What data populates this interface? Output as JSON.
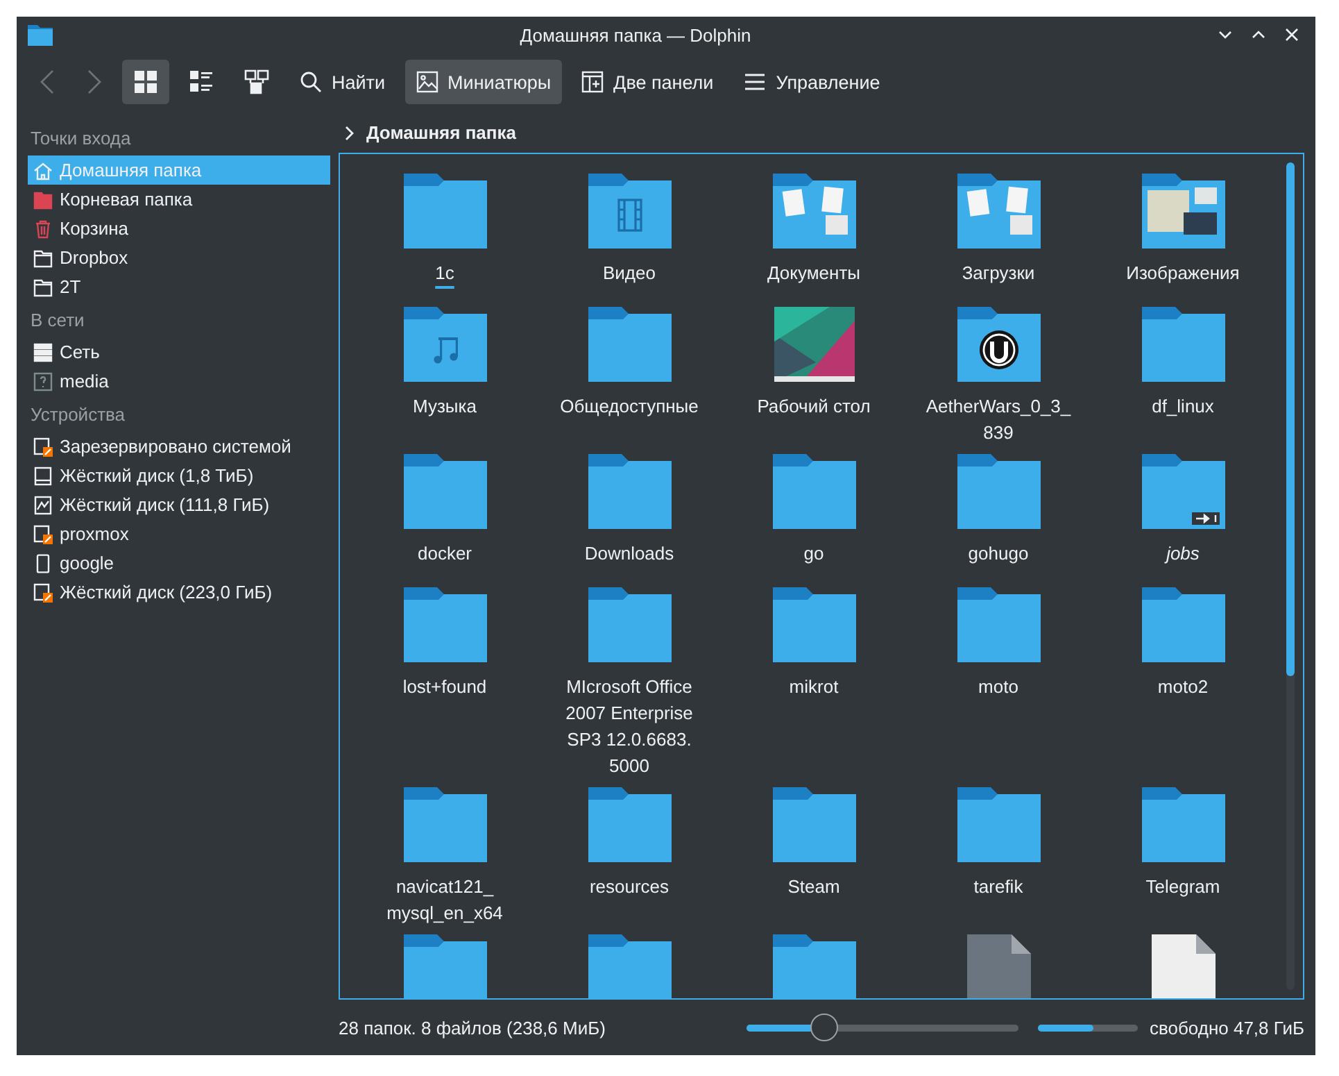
{
  "window": {
    "title": "Домашняя папка — Dolphin"
  },
  "toolbar": {
    "back": {
      "disabled": true
    },
    "forward": {
      "disabled": true
    },
    "view_modes": [
      {
        "kind": "icons",
        "selected": true
      },
      {
        "kind": "details",
        "selected": false
      },
      {
        "kind": "tree",
        "selected": false
      }
    ],
    "buttons": [
      {
        "kind": "search",
        "label": "Найти",
        "on": false
      },
      {
        "kind": "preview",
        "label": "Миниатюры",
        "on": true
      },
      {
        "kind": "split",
        "label": "Две панели",
        "on": false
      },
      {
        "kind": "menu",
        "label": "Управление",
        "on": false
      }
    ]
  },
  "sidebar": {
    "sections": [
      {
        "title": "Точки входа",
        "items": [
          {
            "kind": "home",
            "label": "Домашняя папка",
            "selected": true
          },
          {
            "kind": "root",
            "label": "Корневая папка",
            "selected": false
          },
          {
            "kind": "trash",
            "label": "Корзина",
            "selected": false
          },
          {
            "kind": "folder",
            "label": "Dropbox",
            "selected": false
          },
          {
            "kind": "folder",
            "label": "2T",
            "selected": false
          }
        ]
      },
      {
        "title": "В сети",
        "items": [
          {
            "kind": "network",
            "label": "Сеть",
            "selected": false
          },
          {
            "kind": "unknown",
            "label": "media",
            "selected": false
          }
        ]
      },
      {
        "title": "Устройства",
        "items": [
          {
            "kind": "drive-warn",
            "label": "Зарезервировано системой",
            "selected": false
          },
          {
            "kind": "drive",
            "label": "Жёсткий диск (1,8 ТиБ)",
            "selected": false
          },
          {
            "kind": "drive-image",
            "label": "Жёсткий диск (111,8 ГиБ)",
            "selected": false
          },
          {
            "kind": "drive-warn",
            "label": "proxmox",
            "selected": false
          },
          {
            "kind": "phone",
            "label": "google",
            "selected": false
          },
          {
            "kind": "drive-warn",
            "label": "Жёсткий диск (223,0 ГиБ)",
            "selected": false
          }
        ]
      }
    ]
  },
  "breadcrumb": "Домашняя папка",
  "files": [
    {
      "kind": "folder",
      "name": "1c",
      "current": true,
      "link": false
    },
    {
      "kind": "video",
      "name": "Видео",
      "current": false,
      "link": false
    },
    {
      "kind": "docs",
      "name": "Документы",
      "current": false,
      "link": false
    },
    {
      "kind": "docs",
      "name": "Загрузки",
      "current": false,
      "link": false
    },
    {
      "kind": "pictures",
      "name": "Изображения",
      "current": false,
      "link": false
    },
    {
      "kind": "music",
      "name": "Музыка",
      "current": false,
      "link": false
    },
    {
      "kind": "folder",
      "name": "Общедоступные",
      "current": false,
      "link": false
    },
    {
      "kind": "wallpaper",
      "name": "Рабочий стол",
      "current": false,
      "link": false
    },
    {
      "kind": "unreal",
      "name": "AetherWars_0_3_839",
      "current": false,
      "link": false
    },
    {
      "kind": "folder",
      "name": "df_linux",
      "current": false,
      "link": false
    },
    {
      "kind": "folder",
      "name": "docker",
      "current": false,
      "link": false
    },
    {
      "kind": "folder",
      "name": "Downloads",
      "current": false,
      "link": false
    },
    {
      "kind": "folder",
      "name": "go",
      "current": false,
      "link": false
    },
    {
      "kind": "folder",
      "name": "gohugo",
      "current": false,
      "link": false
    },
    {
      "kind": "folder",
      "name": "jobs",
      "current": false,
      "link": true
    },
    {
      "kind": "folder",
      "name": "lost+found",
      "current": false,
      "link": false
    },
    {
      "kind": "folder",
      "name": "MIcrosoft Office 2007 Enterprise SP3 12.0.6683. 5000",
      "current": false,
      "link": false
    },
    {
      "kind": "folder",
      "name": "mikrot",
      "current": false,
      "link": false
    },
    {
      "kind": "folder",
      "name": "moto",
      "current": false,
      "link": false
    },
    {
      "kind": "folder",
      "name": "moto2",
      "current": false,
      "link": false
    },
    {
      "kind": "folder",
      "name": "navicat121_ mysql_en_x64",
      "current": false,
      "link": false
    },
    {
      "kind": "folder",
      "name": "resources",
      "current": false,
      "link": false
    },
    {
      "kind": "folder",
      "name": "Steam",
      "current": false,
      "link": false
    },
    {
      "kind": "folder",
      "name": "tarefik",
      "current": false,
      "link": false
    },
    {
      "kind": "folder",
      "name": "Telegram",
      "current": false,
      "link": false
    },
    {
      "kind": "folder",
      "current": false,
      "link": false
    },
    {
      "kind": "folder",
      "current": false,
      "link": false
    },
    {
      "kind": "folder",
      "current": false,
      "link": false
    },
    {
      "kind": "file-dark",
      "current": false,
      "link": false
    },
    {
      "kind": "file-light",
      "current": false,
      "link": false
    }
  ],
  "status_bar": {
    "summary": "28 папок. 8 файлов (238,6 МиБ)",
    "zoom": {
      "level": 0.28
    },
    "space": {
      "level": 0.55
    },
    "free": "свободно 47,8 ГиБ"
  }
}
